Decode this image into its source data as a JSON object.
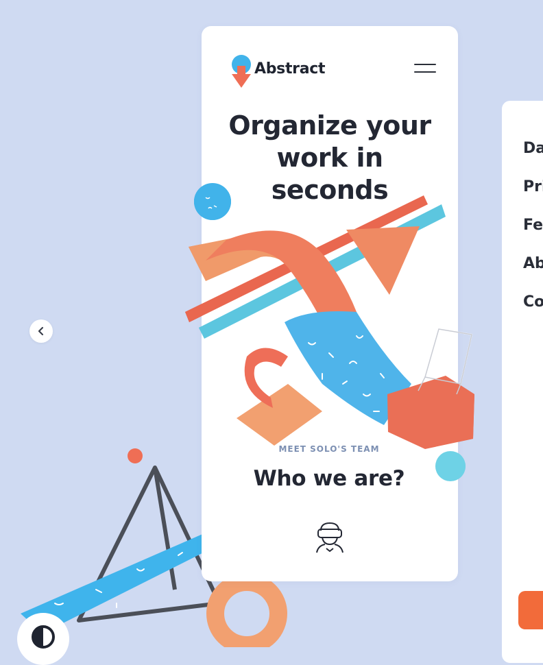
{
  "header": {
    "brand_name": "Abstract",
    "menu_icon": "hamburger-menu-icon",
    "logo_icon": "abstract-logo-icon"
  },
  "hero": {
    "headline_line1": "Organize your",
    "headline_line2": "work in",
    "headline_line3": "seconds"
  },
  "team": {
    "eyebrow": "MEET SOLO'S TEAM",
    "title": "Who we are?",
    "icon": "vr-headset-user-icon"
  },
  "side_menu": {
    "items": [
      {
        "label": "Dashboard"
      },
      {
        "label": "Pricing"
      },
      {
        "label": "Features"
      },
      {
        "label": "About"
      },
      {
        "label": "Contact"
      }
    ]
  },
  "controls": {
    "prev_icon": "chevron-left-icon",
    "theme_icon": "contrast-theme-icon"
  },
  "colors": {
    "background": "#cfdaf2",
    "accent_orange": "#f26b3a",
    "accent_blue": "#4fb6e8",
    "coral": "#ee7a5c",
    "text_dark": "#232733",
    "eyebrow": "#7c8fb2"
  }
}
